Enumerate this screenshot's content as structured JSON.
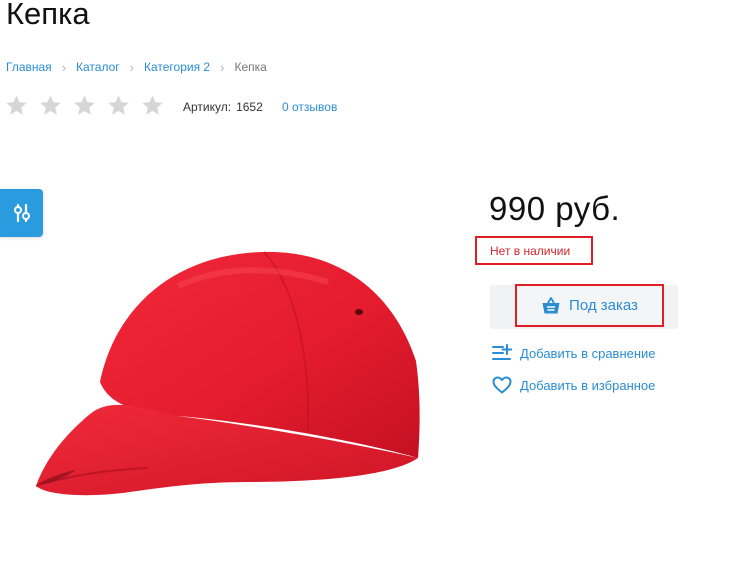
{
  "product": {
    "title": "Кепка",
    "price": "990 руб.",
    "stock_status": "Нет в наличии",
    "article_label": "Артикул:",
    "article_value": "1652",
    "reviews_link": "0 отзывов",
    "rating": {
      "value": 0,
      "max": 5
    }
  },
  "breadcrumb": {
    "items": [
      {
        "label": "Главная"
      },
      {
        "label": "Каталог"
      },
      {
        "label": "Категория 2"
      },
      {
        "label": "Кепка"
      }
    ]
  },
  "actions": {
    "order_label": "Под заказ",
    "compare_label": "Добавить в сравнение",
    "favorite_label": "Добавить в избранное"
  },
  "icons": {
    "filter": "sliders-icon",
    "basket": "basket-icon",
    "compare": "compare-icon",
    "favorite": "heart-icon",
    "star": "star-icon"
  },
  "colors": {
    "accent": "#2a8dd4",
    "filter_tab": "#2b9be0",
    "highlight_border": "#e01e25",
    "star_empty": "#d6d6d6",
    "product_red": "#e8202e"
  }
}
